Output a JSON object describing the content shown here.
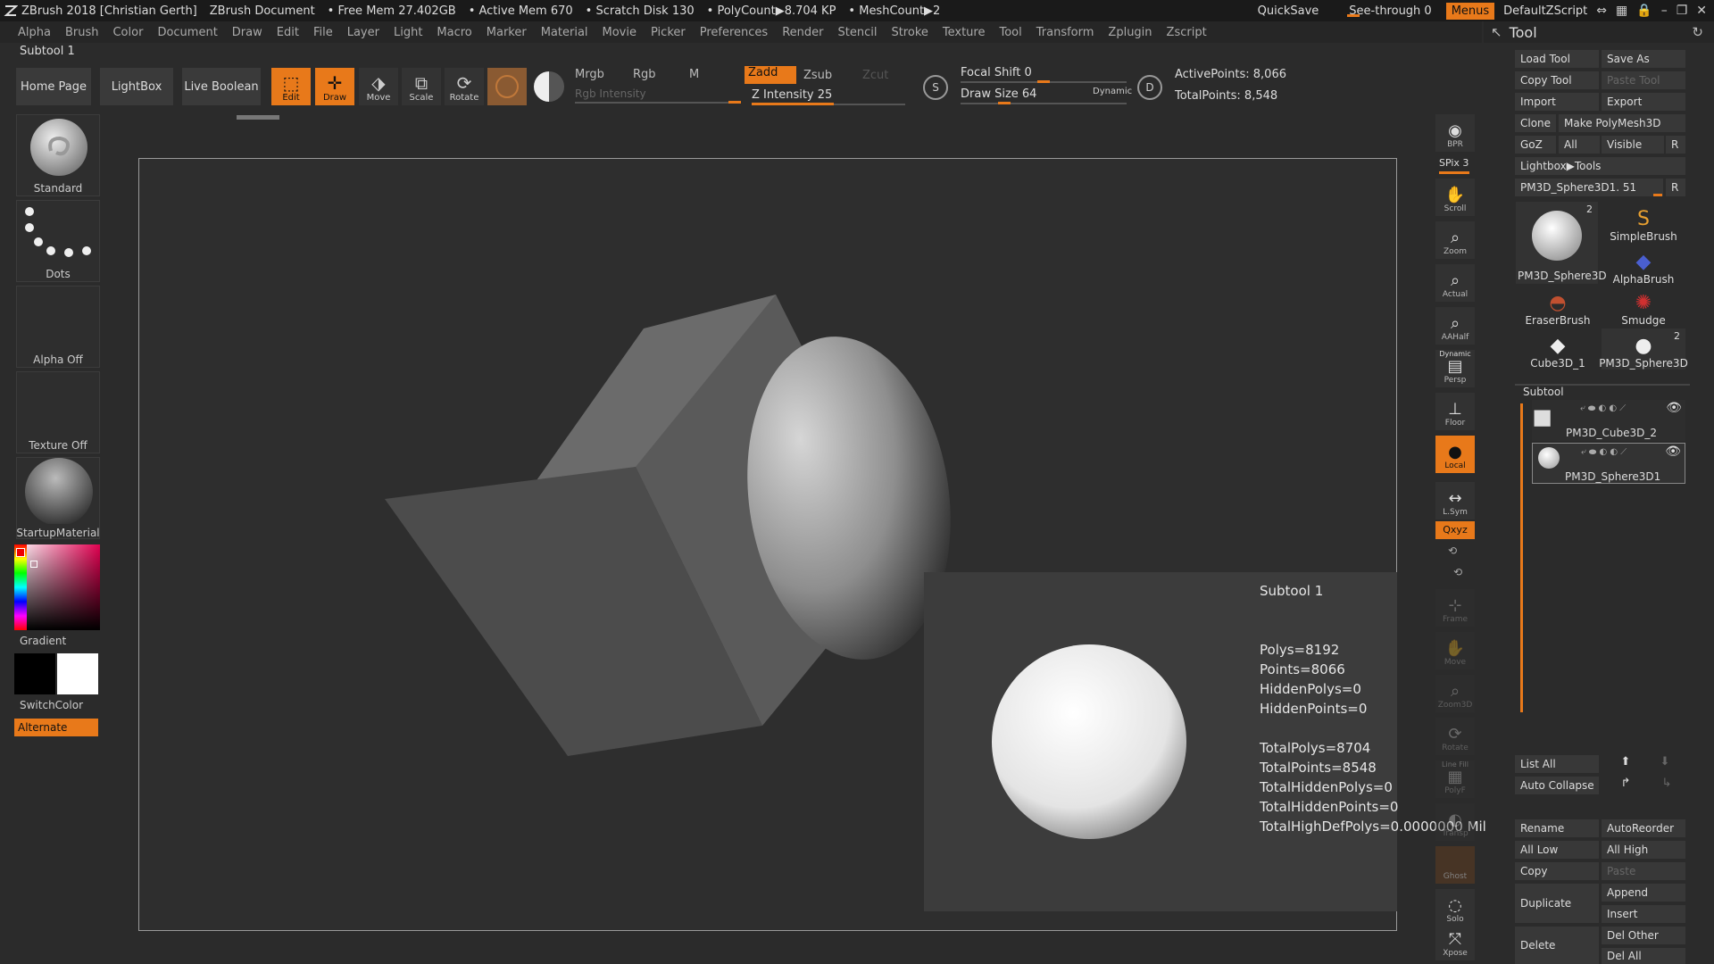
{
  "titlebar": {
    "app": "ZBrush 2018 [Christian Gerth]",
    "document": "ZBrush Document",
    "free_mem": "• Free Mem 27.402GB",
    "active_mem": "• Active Mem 670",
    "scratch": "• Scratch Disk 130",
    "polycount": "• PolyCount▶8.704 KP",
    "meshcount": "• MeshCount▶2",
    "quicksave": "QuickSave",
    "seethrough": "See-through  0",
    "menus": "Menus",
    "script": "DefaultZScript"
  },
  "menu_items": [
    "Alpha",
    "Brush",
    "Color",
    "Document",
    "Draw",
    "Edit",
    "File",
    "Layer",
    "Light",
    "Macro",
    "Marker",
    "Material",
    "Movie",
    "Picker",
    "Preferences",
    "Render",
    "Stencil",
    "Stroke",
    "Texture",
    "Tool",
    "Transform",
    "Zplugin",
    "Zscript"
  ],
  "tool_header": "Tool",
  "subtool_label": "Subtool 1",
  "toolbar": {
    "home": "Home Page",
    "lightbox": "LightBox",
    "live_boolean": "Live Boolean",
    "edit": "Edit",
    "draw": "Draw",
    "move": "Move",
    "scale": "Scale",
    "rotate": "Rotate",
    "mrgb": "Mrgb",
    "rgb": "Rgb",
    "m": "M",
    "rgb_intensity": "Rgb Intensity",
    "zadd": "Zadd",
    "zsub": "Zsub",
    "zcut": "Zcut",
    "z_intensity": "Z Intensity 25",
    "focal_shift": "Focal Shift 0",
    "draw_size": "Draw Size 64",
    "dynamic": "Dynamic",
    "active_points": "ActivePoints: 8,066",
    "total_points": "TotalPoints: 8,548"
  },
  "left_shelf": {
    "brush": "Standard",
    "stroke": "Dots",
    "alpha": "Alpha Off",
    "texture": "Texture Off",
    "material": "StartupMaterial",
    "gradient": "Gradient",
    "switchcolor": "SwitchColor",
    "alternate": "Alternate"
  },
  "right_shelf": {
    "bpr": "BPR",
    "spix": "SPix 3",
    "scroll": "Scroll",
    "zoom": "Zoom",
    "actual": "Actual",
    "aahalf": "AAHalf",
    "persp_top": "Dynamic",
    "persp": "Persp",
    "floor": "Floor",
    "local": "Local",
    "lsym": "L.Sym",
    "xyz": "Qxyz",
    "frame": "Frame",
    "move": "Move",
    "zoom3d": "Zoom3D",
    "rotate": "Rotate",
    "polyf_top": "Line Fill",
    "polyf": "PolyF",
    "transp": "Transp",
    "ghost": "Ghost",
    "solo": "Solo",
    "xpose": "Xpose"
  },
  "info_popup": {
    "title": "Subtool 1",
    "polys": "Polys=8192",
    "points": "Points=8066",
    "hidden_polys": "HiddenPolys=0",
    "hidden_points": "HiddenPoints=0",
    "total_polys": "TotalPolys=8704",
    "total_points": "TotalPoints=8548",
    "total_hidden_polys": "TotalHiddenPolys=0",
    "total_hidden_points": "TotalHiddenPoints=0",
    "total_highdef": "TotalHighDefPolys=0.0000000 Mil"
  },
  "tool_panel": {
    "load_tool": "Load Tool",
    "save_as": "Save As",
    "copy_tool": "Copy Tool",
    "paste_tool": "Paste Tool",
    "import": "Import",
    "export": "Export",
    "clone": "Clone",
    "make_polymesh": "Make PolyMesh3D",
    "goz": "GoZ",
    "all": "All",
    "visible": "Visible",
    "r": "R",
    "lightbox_tools": "Lightbox▶Tools",
    "current_tool": "PM3D_Sphere3D1. 51",
    "tools": [
      {
        "name": "PM3D_Sphere3D",
        "badge": "2"
      },
      {
        "name": "SimpleBrush",
        "badge": ""
      },
      {
        "name": "AlphaBrush",
        "badge": ""
      },
      {
        "name": "EraserBrush",
        "badge": ""
      },
      {
        "name": "Smudge",
        "badge": ""
      },
      {
        "name": "Cube3D_1",
        "badge": ""
      },
      {
        "name": "PM3D_Sphere3D",
        "badge": "2"
      }
    ],
    "subtool_header": "Subtool",
    "subtools": [
      "PM3D_Cube3D_2",
      "PM3D_Sphere3D1"
    ],
    "list_all": "List All",
    "auto_collapse": "Auto Collapse",
    "rename": "Rename",
    "autoreorder": "AutoReorder",
    "all_low": "All Low",
    "all_high": "All High",
    "copy": "Copy",
    "paste": "Paste",
    "duplicate": "Duplicate",
    "append": "Append",
    "insert": "Insert",
    "delete": "Delete",
    "del_other": "Del Other",
    "del_all": "Del All"
  }
}
